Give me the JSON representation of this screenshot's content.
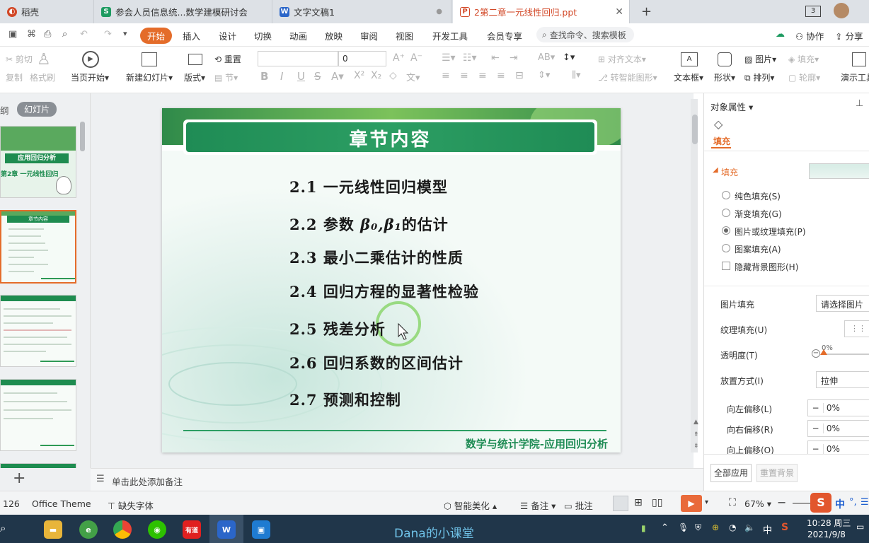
{
  "tabs": [
    {
      "label": "稻壳",
      "icon": "wps-docer-icon",
      "color": "#d24726"
    },
    {
      "label": "参会人员信息统...数学建模研讨会",
      "icon": "spreadsheet-icon",
      "color": "#1e9b61"
    },
    {
      "label": "文字文稿1",
      "icon": "word-doc-icon",
      "color": "#2b66c9"
    },
    {
      "label": "2第二章一元线性回归.ppt",
      "icon": "presentation-icon",
      "color": "#d24726"
    }
  ],
  "tab_badge": "3",
  "menu": [
    "开始",
    "插入",
    "设计",
    "切换",
    "动画",
    "放映",
    "审阅",
    "视图",
    "开发工具",
    "会员专享"
  ],
  "search_placeholder": "查找命令、搜索模板",
  "collab": "协作",
  "share": "分享",
  "ribbon": {
    "cut": "剪切",
    "copy": "复制",
    "format_painter": "格式刷",
    "play_current": "当页开始",
    "new_slide": "新建幻灯片",
    "layout": "版式",
    "section": "节",
    "reset": "重置",
    "font_size": "0",
    "align_text": "对齐文本",
    "convert_smartart": "转智能图形",
    "textbox": "文本框",
    "shape": "形状",
    "picture": "图片",
    "fill": "填充",
    "arrange": "排列",
    "outline": "轮廓",
    "present_tool": "演示工具"
  },
  "left_tabs": {
    "outline": "纲",
    "slides": "幻灯片"
  },
  "slide": {
    "title": "章节内容",
    "items": [
      {
        "num": "2.1",
        "text": "一元线性回归模型"
      },
      {
        "num": "2.2",
        "text": "参数",
        "math": "β₀,β₁",
        "tail": "的估计"
      },
      {
        "num": "2.3",
        "text": "最小二乘估计的性质"
      },
      {
        "num": "2.4",
        "text": "回归方程的显著性检验"
      },
      {
        "num": "2.5",
        "text": "残差分析"
      },
      {
        "num": "2.6",
        "text": "回归系数的区间估计"
      },
      {
        "num": "2.7",
        "text": "预测和控制"
      }
    ],
    "footer": "数学与统计学院-应用回归分析"
  },
  "thumb1": {
    "title": "应用回归分析",
    "sub": "第2章 一元线性回归"
  },
  "thumb2": {
    "title": "章节内容"
  },
  "notes_placeholder": "单击此处添加备注",
  "right_panel": {
    "header": "对象属性",
    "tab": "填充",
    "section": "填充",
    "options": [
      "纯色填充(S)",
      "渐变填充(G)",
      "图片或纹理填充(P)",
      "图案填充(A)"
    ],
    "hide_bg": "隐藏背景图形(H)",
    "picture_fill_label": "图片填充",
    "picture_fill_value": "请选择图片",
    "texture_fill_label": "纹理填充(U)",
    "transparency_label": "透明度(T)",
    "transparency_value": "0%",
    "placement_label": "放置方式(I)",
    "placement_value": "拉伸",
    "offset_left_label": "向左偏移(L)",
    "offset_left": "0%",
    "offset_right_label": "向右偏移(R)",
    "offset_right": "0%",
    "offset_up_label": "向上偏移(O)",
    "offset_up": "0%",
    "apply_all": "全部应用",
    "reset_bg": "重置背景"
  },
  "status": {
    "slide_info": "126",
    "theme": "Office Theme",
    "missing_font": "缺失字体",
    "smart": "智能美化",
    "notes": "备注",
    "comment": "批注",
    "zoom": "67%"
  },
  "taskbar": {
    "watermark": "Dana的小课堂",
    "time": "10:28 周三",
    "date": "2021/9/8",
    "ime": "中",
    "ime2": "中"
  }
}
